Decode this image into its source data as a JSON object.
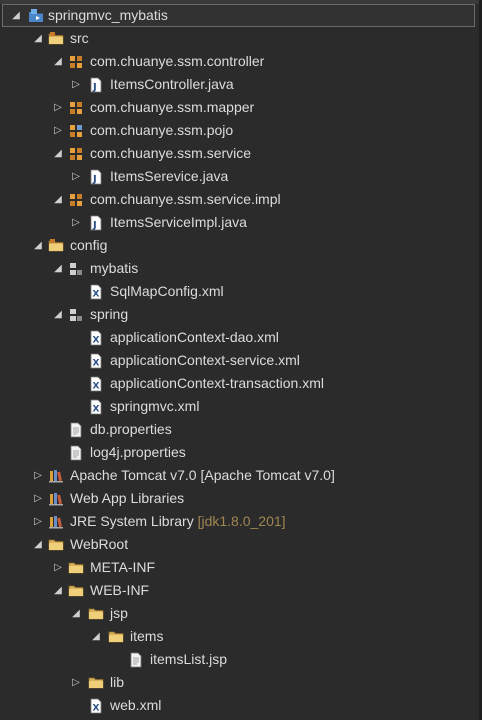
{
  "project": {
    "label": "springmvc_mybatis"
  },
  "tree": {
    "src": {
      "label": "src"
    },
    "controller_pkg": {
      "label": "com.chuanye.ssm.controller"
    },
    "items_controller": {
      "label": "ItemsController.java"
    },
    "mapper_pkg": {
      "label": "com.chuanye.ssm.mapper"
    },
    "pojo_pkg": {
      "label": "com.chuanye.ssm.pojo"
    },
    "service_pkg": {
      "label": "com.chuanye.ssm.service"
    },
    "items_serevice": {
      "label": "ItemsSerevice.java"
    },
    "service_impl_pkg": {
      "label": "com.chuanye.ssm.service.impl"
    },
    "items_service_impl": {
      "label": "ItemsServiceImpl.java"
    },
    "config": {
      "label": "config"
    },
    "mybatis": {
      "label": "mybatis"
    },
    "sqlmapconfig": {
      "label": "SqlMapConfig.xml"
    },
    "spring": {
      "label": "spring"
    },
    "ctx_dao": {
      "label": "applicationContext-dao.xml"
    },
    "ctx_service": {
      "label": "applicationContext-service.xml"
    },
    "ctx_transaction": {
      "label": "applicationContext-transaction.xml"
    },
    "springmvc_xml": {
      "label": "springmvc.xml"
    },
    "db_properties": {
      "label": "db.properties"
    },
    "log4j_properties": {
      "label": "log4j.properties"
    },
    "tomcat": {
      "label": "Apache Tomcat v7.0 [Apache Tomcat v7.0]"
    },
    "webapp_libs": {
      "label": "Web App Libraries"
    },
    "jre": {
      "label": "JRE System Library",
      "decoration": "[jdk1.8.0_201]"
    },
    "webroot": {
      "label": "WebRoot"
    },
    "meta_inf": {
      "label": "META-INF"
    },
    "web_inf": {
      "label": "WEB-INF"
    },
    "jsp": {
      "label": "jsp"
    },
    "items": {
      "label": "items"
    },
    "items_list_jsp": {
      "label": "itemsList.jsp"
    },
    "lib": {
      "label": "lib"
    },
    "web_xml": {
      "label": "web.xml"
    }
  },
  "colors": {
    "background": "#2b2b2b",
    "text": "#dcdcdc",
    "decoration": "#a08652",
    "selection_border": "#6b6b6b"
  }
}
